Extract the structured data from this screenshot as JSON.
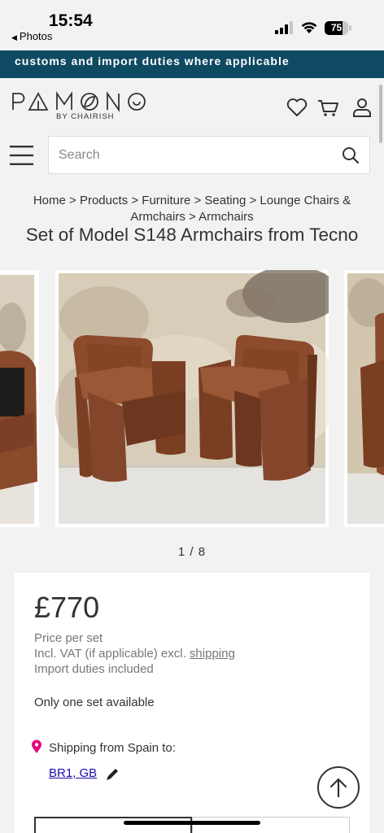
{
  "status": {
    "time": "15:54",
    "back_label": "Photos",
    "battery": "75",
    "battery_fraction": 0.75
  },
  "banner": {
    "text": "customs and import duties where applicable"
  },
  "header": {
    "logo": "PAMONO",
    "logo_sub": "BY CHAIRISH",
    "icons": [
      "heart-icon",
      "cart-icon",
      "user-icon"
    ]
  },
  "search": {
    "placeholder": "Search"
  },
  "breadcrumb": {
    "items": [
      "Home",
      "Products",
      "Furniture",
      "Seating",
      "Lounge Chairs & Armchairs",
      "Armchairs"
    ],
    "separator": ">"
  },
  "product": {
    "title": "Set of Model S148 Armchairs from Tecno",
    "pagination": "1 / 8",
    "price": "£770",
    "price_unit": "Price per set",
    "vat_prefix": "Incl. VAT (if applicable) excl.",
    "vat_link": "shipping",
    "import_note": "Import duties included",
    "availability": "Only one set available",
    "shipping_label": "Shipping from Spain to:",
    "shipping_location": "BR1, GB"
  },
  "colors": {
    "banner": "#0f4a63",
    "leather": "#8a4a2c",
    "pin": "#e6007e",
    "link": "#1a0dab"
  }
}
